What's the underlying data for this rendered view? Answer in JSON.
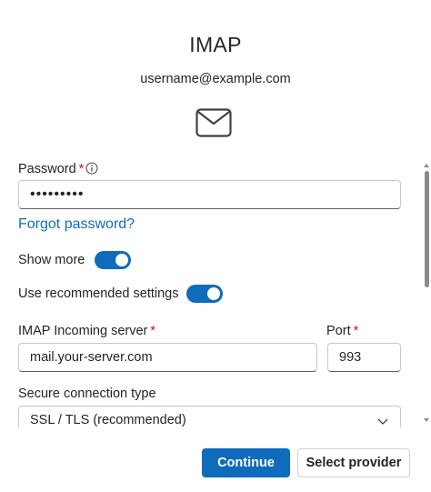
{
  "header": {
    "title": "IMAP",
    "account_email": "username@example.com",
    "icon": "envelope-icon"
  },
  "form": {
    "password": {
      "label": "Password",
      "required_mark": "*",
      "info_icon": "info-icon",
      "value_masked": "•••••••••"
    },
    "forgot_password_link": "Forgot password?",
    "show_more": {
      "label": "Show more",
      "on": true
    },
    "use_recommended": {
      "label": "Use recommended settings",
      "on": true
    },
    "incoming_server": {
      "label": "IMAP Incoming server",
      "required_mark": "*",
      "value": "mail.your-server.com"
    },
    "port": {
      "label": "Port",
      "required_mark": "*",
      "value": "993"
    },
    "secure_connection": {
      "label": "Secure connection type",
      "selected": "SSL / TLS (recommended)"
    }
  },
  "footer": {
    "continue_label": "Continue",
    "select_provider_label": "Select provider"
  },
  "colors": {
    "accent": "#0f6cbd",
    "required": "#c50f1f"
  }
}
